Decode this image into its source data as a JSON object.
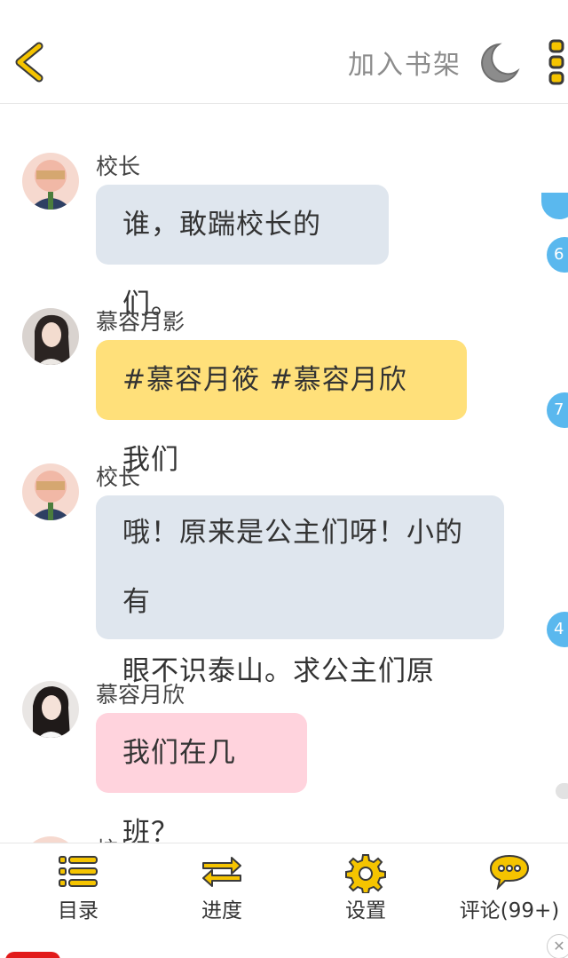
{
  "header": {
    "bookshelf_label": "加入书架",
    "back_icon": "chevron-left-icon",
    "night_icon": "moon-icon",
    "more_icon": "more-vertical-icon"
  },
  "messages": [
    {
      "sender": "校长",
      "text": "谁，敢踹校长的们。",
      "bubble_color": "#dfe6ee"
    },
    {
      "sender": "慕容月影",
      "text": "#慕容月筱 #慕容月欣 我们",
      "bubble_color": "#ffe07a"
    },
    {
      "sender": "校长",
      "line1": "哦！原来是公主们呀！小的有",
      "line2": "眼不识泰山。求公主们原谅！",
      "bubble_color": "#dfe6ee"
    },
    {
      "sender": "慕容月欣",
      "text": "我们在几班？",
      "bubble_color": "#ffd3dd"
    },
    {
      "sender": "校长"
    }
  ],
  "side_badges": [
    "6",
    "7",
    "4"
  ],
  "bottom_nav": [
    {
      "label": "目录",
      "icon": "list-icon"
    },
    {
      "label": "进度",
      "icon": "swap-arrows-icon"
    },
    {
      "label": "设置",
      "icon": "gear-icon"
    },
    {
      "label": "评论(99+)",
      "icon": "comment-bubble-icon"
    }
  ],
  "colors": {
    "accent_yellow": "#f5c400",
    "badge_blue": "#5ab8ee",
    "gray_bubble": "#dfe6ee",
    "yellow_bubble": "#ffe07a",
    "pink_bubble": "#ffd3dd"
  }
}
